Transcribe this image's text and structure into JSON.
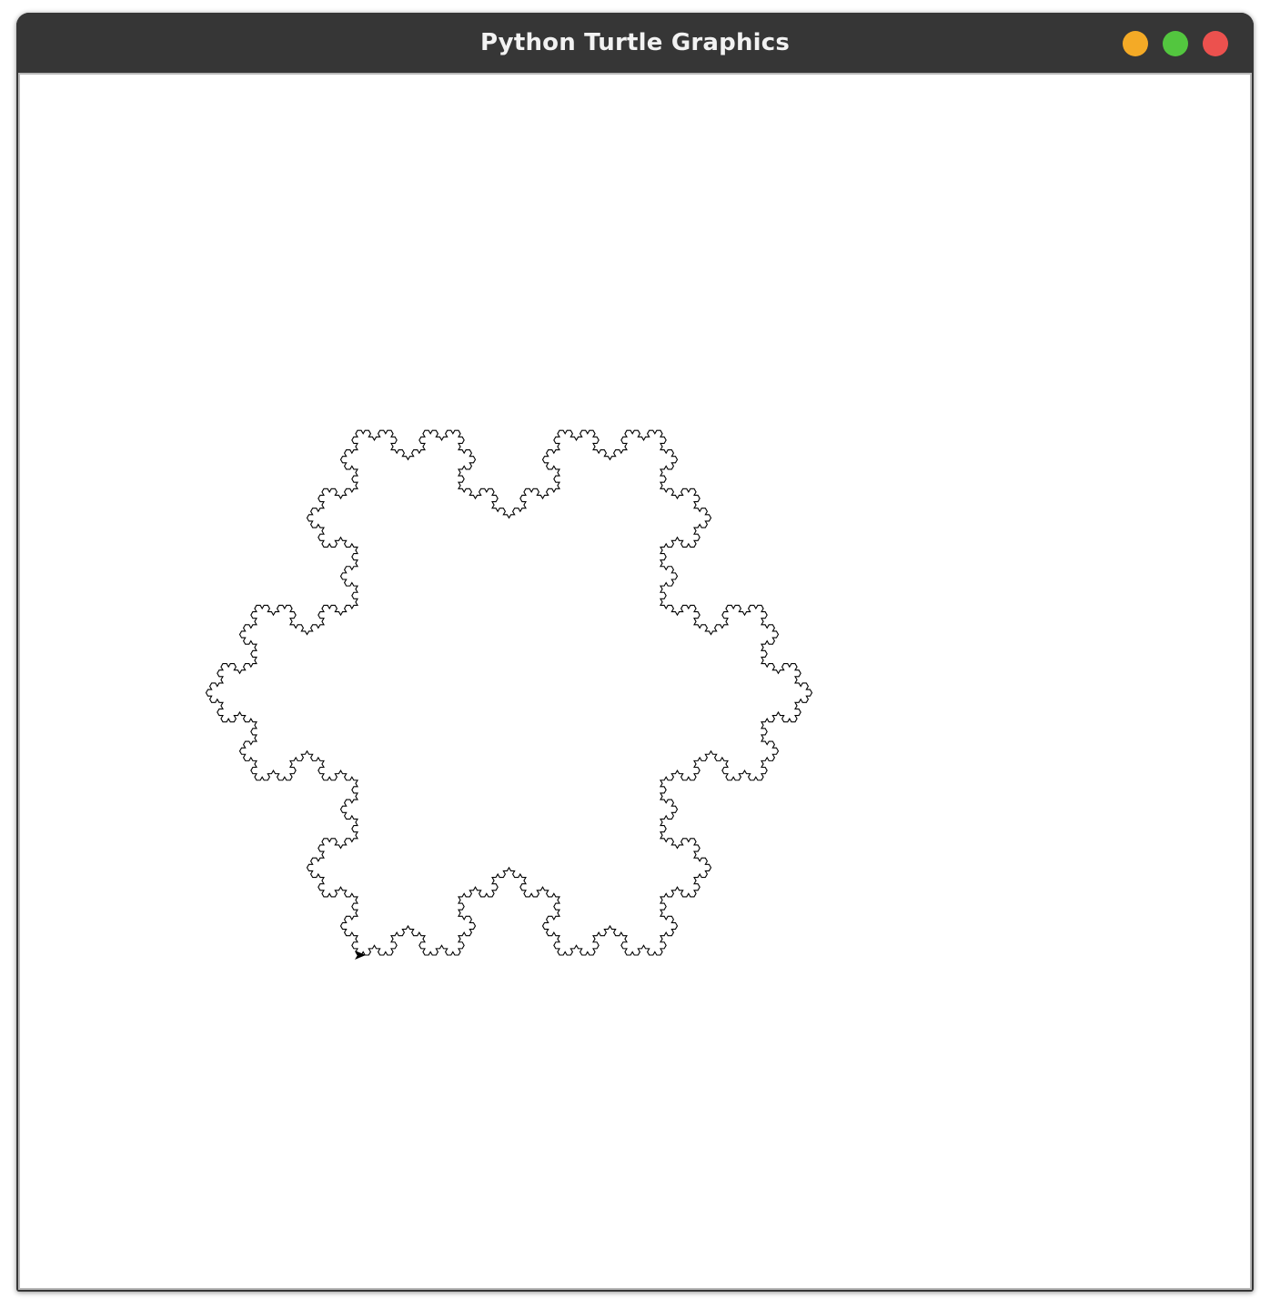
{
  "window": {
    "title": "Python Turtle Graphics"
  },
  "controls": {
    "minimize": {
      "icon": "minimize-icon",
      "color": "#f4aa26"
    },
    "maximize": {
      "icon": "maximize-icon",
      "color": "#53c63f"
    },
    "close": {
      "icon": "close-icon",
      "color": "#ec514e"
    }
  },
  "canvas": {
    "background": "#ffffff",
    "pen_color": "#000000",
    "fill": "none"
  },
  "drawing": {
    "shape": "koch-snowflake",
    "recursion_depth": 4,
    "sides": 6,
    "cursor_icon": "turtle-arrow-icon"
  }
}
